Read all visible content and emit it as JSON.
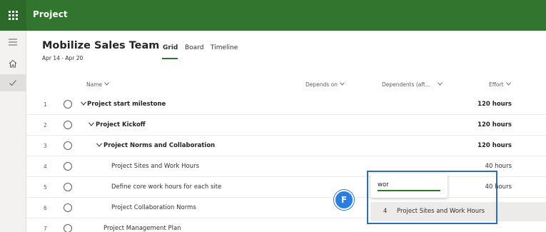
{
  "app": {
    "title": "Project"
  },
  "rail": {
    "items": [
      "menu-icon",
      "home-icon",
      "check-icon"
    ]
  },
  "plan": {
    "title": "Mobilize Sales Team",
    "dates": "Apr 14 - Apr 20"
  },
  "tabs": [
    {
      "label": "Grid",
      "active": true
    },
    {
      "label": "Board",
      "active": false
    },
    {
      "label": "Timeline",
      "active": false
    }
  ],
  "columns": {
    "name": "Name",
    "depends_on": "Depends on",
    "dependents": "Dependents (aft...",
    "effort": "Effort"
  },
  "rows": [
    {
      "num": "1",
      "name": "Project start milestone",
      "effort": "120 hours",
      "bold": true,
      "indent": 0,
      "chevron": true
    },
    {
      "num": "2",
      "name": "Project Kickoff",
      "effort": "120 hours",
      "bold": true,
      "indent": 1,
      "chevron": true
    },
    {
      "num": "3",
      "name": "Project Norms and Collaboration",
      "effort": "120 hours",
      "bold": true,
      "indent": 2,
      "chevron": true
    },
    {
      "num": "4",
      "name": "Project Sites and Work Hours",
      "effort": "40 hours",
      "bold": false,
      "indent": 3,
      "chevron": false
    },
    {
      "num": "5",
      "name": "Define core work hours for each site",
      "effort": "40 hours",
      "bold": false,
      "indent": 3,
      "chevron": false
    },
    {
      "num": "6",
      "name": "Project Collaboration Norms",
      "effort": "",
      "bold": false,
      "indent": 3,
      "chevron": false
    },
    {
      "num": "7",
      "name": "Project Management Plan",
      "effort": "",
      "bold": false,
      "indent": 2,
      "chevron": false
    }
  ],
  "dependency_editor": {
    "input_value": "wor",
    "suggestion": {
      "num": "4",
      "label": "Project Sites and Work Hours"
    }
  },
  "callout": {
    "label": "F"
  },
  "colors": {
    "brand": "#31752f",
    "callout": "#2a7de1",
    "highlight": "#2f6db5"
  }
}
